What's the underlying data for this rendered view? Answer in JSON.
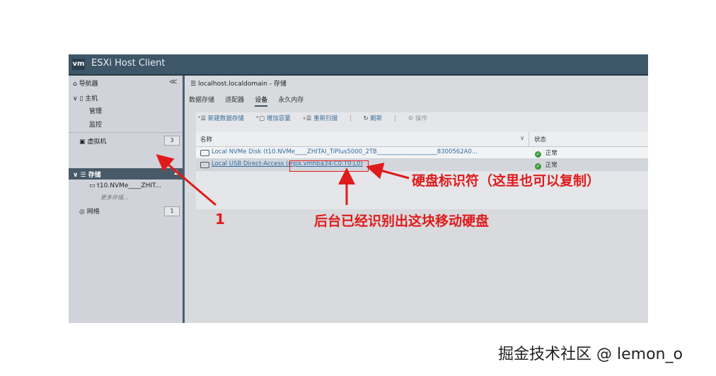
{
  "window": {
    "logo": "vm",
    "title": "ESXi Host Client"
  },
  "sidebar": {
    "navigator_label": "导航器",
    "collapse_glyph": "≪",
    "host_label": "主机",
    "host_children": [
      "管理",
      "监控"
    ],
    "vms_label": "虚拟机",
    "vms_count": "3",
    "storage_label": "存储",
    "storage_count": "2",
    "storage_item": "t10.NVMe____ZHIT...",
    "more_storage": "更多存储...",
    "network_label": "网络",
    "network_count": "1"
  },
  "main": {
    "breadcrumb": "localhost.localdomain - 存储",
    "tabs": [
      "数据存储",
      "适配器",
      "设备",
      "永久内存"
    ],
    "active_tab": 2,
    "toolbar": {
      "new_datastore": "新建数据存储",
      "increase_capacity": "增加容量",
      "rescan": "重新扫描",
      "refresh": "刷新",
      "actions": "操作"
    },
    "columns": {
      "name": "名称",
      "state": "状态"
    },
    "rows": [
      {
        "name": "Local NVMe Disk (t10.NVMe____ZHITAI_TiPlus5000_2TB____________________8300562A0...",
        "state": "正常"
      },
      {
        "name": "Local USB Direct-Access (mpx.vmhba34:C0:T0:L0)",
        "state": "正常"
      }
    ]
  },
  "annotations": {
    "number_label": "1",
    "identifier_label": "硬盘标识符（这里也可以复制）",
    "recognized_label": "后台已经识别出这块移动硬盘",
    "color": "#e01b1b"
  },
  "watermark": "掘金技术社区 @ lemon_o"
}
